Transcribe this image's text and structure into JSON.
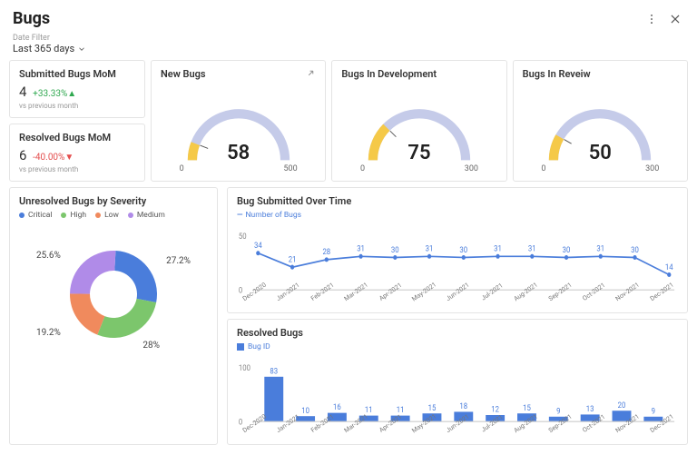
{
  "header": {
    "title": "Bugs"
  },
  "filter": {
    "label": "Date Filter",
    "value": "Last 365 days"
  },
  "kpi_submitted": {
    "title": "Submitted Bugs MoM",
    "value": "4",
    "delta": "+33.33%",
    "delta_icon": "▲",
    "delta_dir": "up",
    "sub": "vs previous month"
  },
  "kpi_resolved": {
    "title": "Resolved Bugs MoM",
    "value": "6",
    "delta": "-40.00%",
    "delta_icon": "▼",
    "delta_dir": "down",
    "sub": "vs previous month"
  },
  "gauges": {
    "new": {
      "title": "New Bugs",
      "value": 58,
      "min": 0,
      "max": 500
    },
    "dev": {
      "title": "Bugs In Development",
      "value": 75,
      "min": 0,
      "max": 300
    },
    "review": {
      "title": "Bugs In Reveiw",
      "value": 50,
      "min": 0,
      "max": 300
    }
  },
  "donut": {
    "title": "Unresolved Bugs by Severity",
    "legend": [
      "Critical",
      "High",
      "Low",
      "Medium"
    ],
    "labels": {
      "critical": "27.2%",
      "high": "28%",
      "low": "19.2%",
      "medium": "25.6%"
    }
  },
  "line": {
    "title": "Bug Submitted Over Time",
    "legend": "Number of Bugs",
    "ymax": 50
  },
  "bars": {
    "title": "Resolved Bugs",
    "legend": "Bug ID",
    "ymax": 100
  },
  "chart_data": {
    "gauges": [
      {
        "name": "New Bugs",
        "value": 58,
        "min": 0,
        "max": 500
      },
      {
        "name": "Bugs In Development",
        "value": 75,
        "min": 0,
        "max": 300
      },
      {
        "name": "Bugs In Review",
        "value": 50,
        "min": 0,
        "max": 300
      }
    ],
    "severity_donut": {
      "type": "pie",
      "title": "Unresolved Bugs by Severity",
      "series": [
        {
          "name": "Critical",
          "value": 27.2,
          "color": "#4a7ddb"
        },
        {
          "name": "High",
          "value": 28.0,
          "color": "#7cc66c"
        },
        {
          "name": "Low",
          "value": 19.2,
          "color": "#f08a5d"
        },
        {
          "name": "Medium",
          "value": 25.6,
          "color": "#b08be8"
        }
      ]
    },
    "submitted_over_time": {
      "type": "line",
      "title": "Bug Submitted Over Time",
      "ylabel": "Number of Bugs",
      "ylim": [
        0,
        50
      ],
      "categories": [
        "Dec-2020",
        "Jan-2021",
        "Feb-2021",
        "Mar-2021",
        "Apr-2021",
        "May-2021",
        "Jun-2021",
        "Jul-2021",
        "Aug-2021",
        "Sep-2021",
        "Oct-2021",
        "Nov-2021",
        "Dec-2021"
      ],
      "values": [
        34,
        21,
        28,
        31,
        30,
        31,
        30,
        31,
        31,
        30,
        31,
        30,
        14
      ]
    },
    "resolved_bugs": {
      "type": "bar",
      "title": "Resolved Bugs",
      "ylabel": "Bug ID",
      "ylim": [
        0,
        100
      ],
      "categories": [
        "Dec-2020",
        "Jan-2021",
        "Feb-2021",
        "Mar-2021",
        "Apr-2021",
        "May-2021",
        "Jun-2021",
        "Jul-2021",
        "Aug-2021",
        "Sep-2021",
        "Oct-2021",
        "Nov-2021",
        "Dec-2021"
      ],
      "values": [
        83,
        10,
        16,
        11,
        11,
        15,
        18,
        12,
        15,
        9,
        13,
        20,
        9
      ]
    }
  }
}
